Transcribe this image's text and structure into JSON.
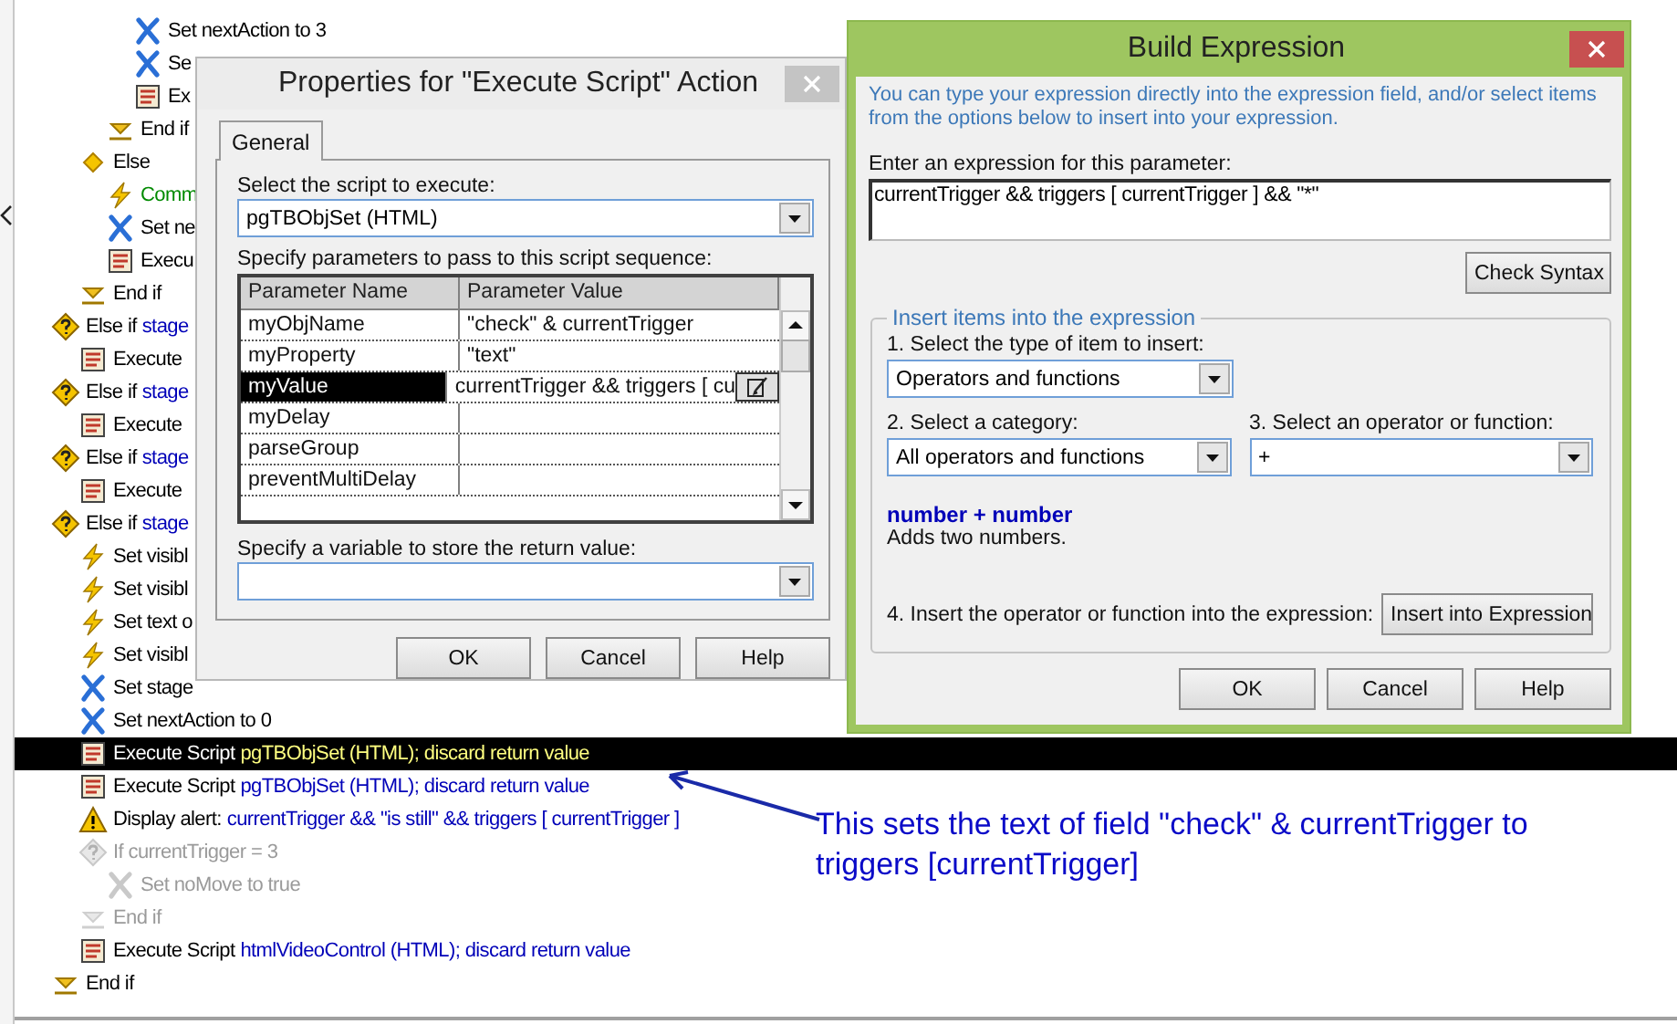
{
  "tree": [
    {
      "kind": "group",
      "children": [
        {
          "kind": "group",
          "children": [
            {
              "kind": "group",
              "children": [
                {
                  "kind": "set",
                  "label": "Set nextAction to 3",
                  "selected": false,
                  "disabled": false
                },
                {
                  "kind": "set",
                  "label": "Se",
                  "selected": false,
                  "disabled": false
                },
                {
                  "kind": "script",
                  "label": "Ex",
                  "selected": false,
                  "disabled": false
                }
              ]
            },
            {
              "kind": "end",
              "label": "End if",
              "selected": false,
              "disabled": false
            }
          ]
        },
        {
          "kind": "else",
          "label": "Else",
          "selected": false,
          "disabled": false,
          "children": [
            {
              "kind": "comment",
              "label": "Comm",
              "selected": false,
              "disabled": false
            },
            {
              "kind": "set",
              "label": "Set ne",
              "selected": false,
              "disabled": false
            },
            {
              "kind": "script",
              "label": "Execu",
              "selected": false,
              "disabled": false
            }
          ]
        },
        {
          "kind": "end",
          "label": "End if",
          "selected": false,
          "disabled": false
        }
      ]
    },
    {
      "kind": "condition",
      "label": "Else if",
      "detail": "stage",
      "selected": false,
      "disabled": false,
      "children": [
        {
          "kind": "script",
          "label": "Execute",
          "selected": false,
          "disabled": false
        }
      ]
    },
    {
      "kind": "condition",
      "label": "Else if",
      "detail": "stage",
      "selected": false,
      "disabled": false,
      "children": [
        {
          "kind": "script",
          "label": "Execute",
          "selected": false,
          "disabled": false
        }
      ]
    },
    {
      "kind": "condition",
      "label": "Else if",
      "detail": "stage",
      "selected": false,
      "disabled": false,
      "children": [
        {
          "kind": "script",
          "label": "Execute",
          "selected": false,
          "disabled": false
        }
      ]
    },
    {
      "kind": "condition",
      "label": "Else if",
      "detail": "stage",
      "selected": false,
      "disabled": false,
      "children": [
        {
          "kind": "command",
          "label": "Set visibl",
          "selected": false,
          "disabled": false
        },
        {
          "kind": "command",
          "label": "Set visibl",
          "selected": false,
          "disabled": false
        },
        {
          "kind": "command",
          "label": "Set text o",
          "selected": false,
          "disabled": false
        },
        {
          "kind": "command",
          "label": "Set visibl",
          "selected": false,
          "disabled": false
        },
        {
          "kind": "set",
          "label": "Set stage",
          "selected": false,
          "disabled": false
        },
        {
          "kind": "set",
          "label": "Set nextAction to 0",
          "selected": false,
          "disabled": false
        },
        {
          "kind": "script",
          "label": "Execute Script",
          "detail": "pgTBObjSet (HTML); discard return value",
          "selected": true,
          "disabled": false
        },
        {
          "kind": "script",
          "label": "Execute Script",
          "detail": "pgTBObjSet (HTML); discard return value",
          "selected": false,
          "disabled": false
        },
        {
          "kind": "alert",
          "label": "Display alert:",
          "detail": "currentTrigger && \"is still\" && triggers [ currentTrigger ]",
          "selected": false,
          "disabled": false
        },
        {
          "kind": "condition",
          "label": "If currentTrigger = 3",
          "selected": false,
          "disabled": true,
          "children": [
            {
              "kind": "set",
              "label": "Set noMove to true",
              "selected": false,
              "disabled": true
            }
          ]
        },
        {
          "kind": "end",
          "label": "End if",
          "selected": false,
          "disabled": true
        },
        {
          "kind": "script",
          "label": "Execute Script",
          "detail": "htmlVideoControl (HTML); discard return value",
          "selected": false,
          "disabled": false
        }
      ]
    },
    {
      "kind": "end",
      "label": "End if",
      "selected": false,
      "disabled": false
    }
  ],
  "properties_dialog": {
    "title": "Properties for \"Execute Script\" Action",
    "tabs": [
      {
        "label": "General",
        "selected": true
      }
    ],
    "script_label": "Select the script to execute:",
    "script_value": "pgTBObjSet (HTML)",
    "parameters_label": "Specify parameters to pass to this script sequence:",
    "columns": [
      "Parameter Name",
      "Parameter Value"
    ],
    "rows": [
      {
        "name": "myObjName",
        "value": "\"check\" & currentTrigger",
        "selected": false
      },
      {
        "name": "myProperty",
        "value": "\"text\"",
        "selected": false
      },
      {
        "name": "myValue",
        "value": "currentTrigger && triggers [ cu",
        "selected": true
      },
      {
        "name": "myDelay",
        "selected": false
      },
      {
        "name": "parseGroup",
        "selected": false
      },
      {
        "name": "preventMultiDelay",
        "selected": false
      }
    ],
    "return_label": "Specify a variable to store the return value:",
    "buttons": [
      "OK",
      "Cancel",
      "Help"
    ]
  },
  "build_expression": {
    "title": "Build Expression",
    "intro": "You can type your expression directly into the expression field, and/or select items from the options below to insert into your expression.",
    "expression_label": "Enter an expression for this parameter:",
    "expression": "currentTrigger && triggers [ currentTrigger ] && \"*\"",
    "check_button": "Check Syntax",
    "group_title": "Insert items into the expression",
    "type_label": "1. Select the type of item to insert:",
    "type_value": "Operators and functions",
    "category_label": "2. Select a category:",
    "category_value": "All operators and functions",
    "operator_label": "3. Select an operator or function:",
    "operator_value": "+",
    "syntax": "number + number",
    "description": "Adds two numbers.",
    "insert_label": "4. Insert the operator or function into the expression:",
    "insert_button": "Insert into Expression",
    "buttons": [
      "OK",
      "Cancel",
      "Help"
    ]
  },
  "annotation": "This sets the text of field \"check\" & currentTrigger to triggers [currentTrigger]"
}
